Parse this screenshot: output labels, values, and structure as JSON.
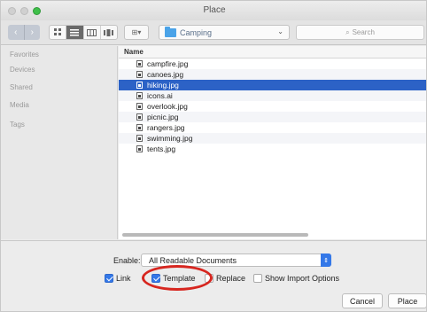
{
  "window": {
    "title": "Place"
  },
  "toolbar": {
    "back_glyph": "‹",
    "forward_glyph": "›",
    "view_modes": [
      "icon-view",
      "list-view",
      "column-view",
      "cover-flow-view"
    ],
    "active_view": "list-view",
    "arrange_glyph": "⊞▾",
    "location": "Camping",
    "location_chevron": "⌃⌄",
    "search_placeholder": "Search"
  },
  "sidebar": {
    "headers": [
      "Favorites",
      "Devices",
      "Shared",
      "Media",
      "Tags"
    ]
  },
  "browser": {
    "column_header": "Name",
    "files": [
      {
        "name": "campfire.jpg",
        "selected": false
      },
      {
        "name": "canoes.jpg",
        "selected": false
      },
      {
        "name": "hiking.jpg",
        "selected": true
      },
      {
        "name": "icons.ai",
        "selected": false
      },
      {
        "name": "overlook.jpg",
        "selected": false
      },
      {
        "name": "picnic.jpg",
        "selected": false
      },
      {
        "name": "rangers.jpg",
        "selected": false
      },
      {
        "name": "swimming.jpg",
        "selected": false
      },
      {
        "name": "tents.jpg",
        "selected": false
      }
    ]
  },
  "options": {
    "enable_label": "Enable:",
    "enable_value": "All Readable Documents",
    "checkboxes": [
      {
        "label": "Link",
        "checked": true
      },
      {
        "label": "Template",
        "checked": true
      },
      {
        "label": "Replace",
        "checked": false
      },
      {
        "label": "Show Import Options",
        "checked": false
      }
    ]
  },
  "buttons": {
    "cancel": "Cancel",
    "place": "Place"
  },
  "colors": {
    "accent": "#3478e8",
    "selection": "#2c62c6",
    "highlight_ring": "#d7261f"
  }
}
